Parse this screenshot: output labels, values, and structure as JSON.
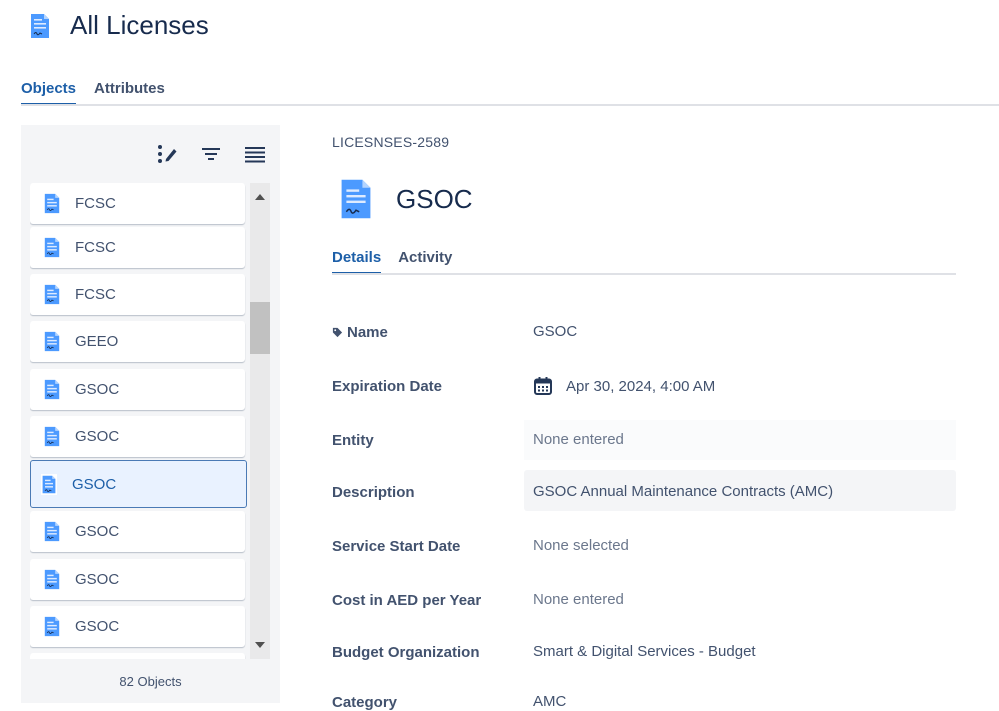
{
  "header": {
    "title": "All Licenses",
    "icon": "license-document-icon"
  },
  "tabs": [
    {
      "label": "Objects",
      "active": true
    },
    {
      "label": "Attributes",
      "active": false
    }
  ],
  "left_panel": {
    "toolbar": [
      "edit-columns-icon",
      "filter-icon",
      "list-view-icon"
    ],
    "items": [
      {
        "label": "FCSC",
        "selected": false
      },
      {
        "label": "FCSC",
        "selected": false
      },
      {
        "label": "FCSC",
        "selected": false
      },
      {
        "label": "GEEO",
        "selected": false
      },
      {
        "label": "GSOC",
        "selected": false
      },
      {
        "label": "GSOC",
        "selected": false
      },
      {
        "label": "GSOC",
        "selected": true
      },
      {
        "label": "GSOC",
        "selected": false
      },
      {
        "label": "GSOC",
        "selected": false
      },
      {
        "label": "GSOC",
        "selected": false
      }
    ],
    "count_label": "82 Objects"
  },
  "detail": {
    "key": "LICESNSES-2589",
    "title": "GSOC",
    "tabs": [
      {
        "label": "Details",
        "active": true
      },
      {
        "label": "Activity",
        "active": false
      }
    ],
    "attributes": [
      {
        "label": "Name",
        "value": "GSOC"
      },
      {
        "label": "Expiration Date",
        "value": "Apr 30, 2024, 4:00 AM"
      },
      {
        "label": "Entity",
        "value": "None entered"
      },
      {
        "label": "Description",
        "value": "GSOC Annual Maintenance Contracts (AMC)"
      },
      {
        "label": "Service Start Date",
        "value": "None selected"
      },
      {
        "label": "Cost in AED per Year",
        "value": "None entered"
      },
      {
        "label": "Budget Organization",
        "value": "Smart & Digital Services - Budget"
      },
      {
        "label": "Category",
        "value": "AMC"
      }
    ]
  },
  "colors": {
    "accent": "#1d5fa8",
    "icon_blue": "#4c9aff",
    "panel_bg": "#f4f5f7"
  }
}
